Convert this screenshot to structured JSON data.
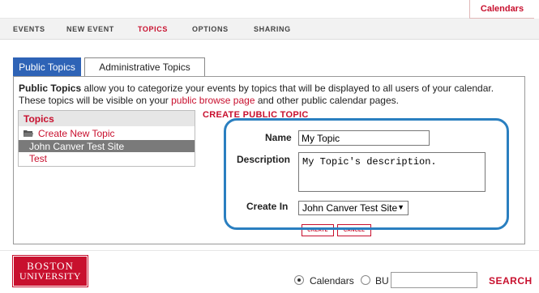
{
  "header": {
    "calendars_tab": "Calendars"
  },
  "nav": {
    "items": [
      "EVENTS",
      "NEW EVENT",
      "TOPICS",
      "OPTIONS",
      "SHARING"
    ],
    "active": "TOPICS"
  },
  "tabs": [
    {
      "label": "Public Topics",
      "active": true
    },
    {
      "label": "Administrative Topics",
      "active": false
    }
  ],
  "intro": {
    "bold": "Public Topics",
    "text1": " allow you to categorize your events by topics that will be displayed to all users of your calendar.",
    "text2": "These topics will be visible on your ",
    "link": "public browse page",
    "text3": " and other public calendar pages."
  },
  "topics_list": {
    "header": "Topics",
    "create_label": "Create New Topic",
    "items": [
      {
        "label": "John Canver Test Site",
        "selected": true
      },
      {
        "label": "Test",
        "selected": false
      }
    ]
  },
  "form": {
    "title": "CREATE PUBLIC TOPIC",
    "name_label": "Name",
    "name_value": "My Topic",
    "description_label": "Description",
    "description_value": "My Topic's description.",
    "create_in_label": "Create In",
    "create_in_value": "John Canver Test Site",
    "create_button": "CREATE",
    "cancel_button": "CANCEL"
  },
  "footer": {
    "logo_line1": "BOSTON",
    "logo_line2": "UNIVERSITY",
    "radio_calendars": "Calendars",
    "radio_bu": "BU",
    "search_value": "",
    "search_button": "SEARCH"
  },
  "colors": {
    "accent_red": "#c8102e",
    "tab_blue": "#2e63b6",
    "highlight_blue": "#2a7fc0"
  }
}
